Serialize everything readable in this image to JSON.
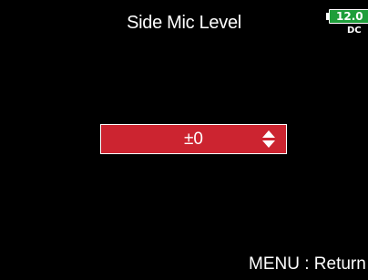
{
  "header": {
    "title": "Side Mic Level"
  },
  "battery": {
    "voltage": "12.0",
    "source": "DC",
    "color": "#1e9e3a"
  },
  "setting": {
    "value": "±0",
    "selector_icon": "up-down-arrows-icon",
    "box_color": "#cc2430"
  },
  "footer": {
    "hint": "MENU : Return"
  }
}
